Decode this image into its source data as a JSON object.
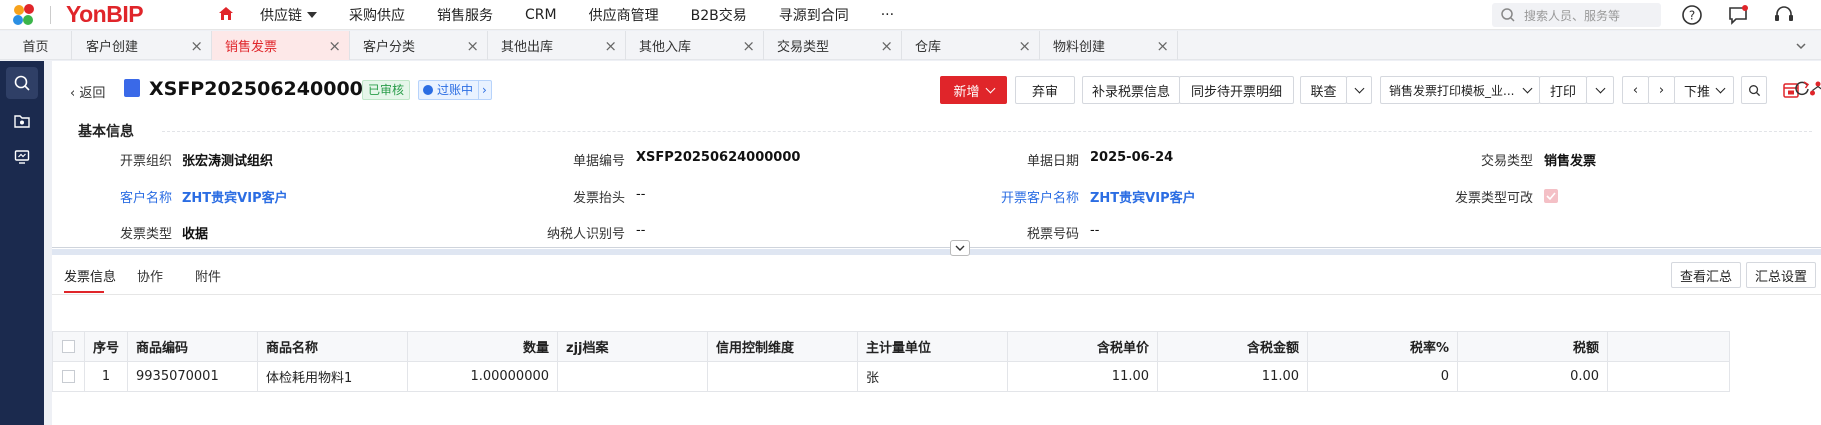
{
  "app": {
    "brand": "YonBIP",
    "nav": [
      {
        "label": "供应链",
        "has_dropdown": true
      },
      {
        "label": "采购供应"
      },
      {
        "label": "销售服务"
      },
      {
        "label": "CRM"
      },
      {
        "label": "供应商管理"
      },
      {
        "label": "B2B交易"
      },
      {
        "label": "寻源到合同"
      },
      {
        "label": "···"
      }
    ],
    "search_placeholder": "搜索人员、服务等"
  },
  "tabs": [
    {
      "label": "首页"
    },
    {
      "label": "客户创建"
    },
    {
      "label": "销售发票",
      "active": true
    },
    {
      "label": "客户分类"
    },
    {
      "label": "其他出库"
    },
    {
      "label": "其他入库"
    },
    {
      "label": "交易类型"
    },
    {
      "label": "仓库"
    },
    {
      "label": "物料创建"
    }
  ],
  "header": {
    "back_label": "返回",
    "doc_no": "XSFP20250624000000",
    "status_badge": "已审核",
    "posting_badge": "过账中",
    "buttons": {
      "new": "新增",
      "discard": "弃审",
      "add_tax_info": "补录税票信息",
      "sync_pending": "同步待开票明细",
      "linked": "联查",
      "print_template": "销售发票打印模板_业...",
      "print": "打印",
      "push_down": "下推"
    }
  },
  "basic_info": {
    "title": "基本信息",
    "fields": [
      {
        "label": "开票组织",
        "value": "张宏涛测试组织"
      },
      {
        "label": "单据编号",
        "value": "XSFP20250624000000"
      },
      {
        "label": "单据日期",
        "value": "2025-06-24"
      },
      {
        "label": "交易类型",
        "value": "销售发票"
      },
      {
        "label": "客户名称",
        "value": "ZHT贵宾VIP客户"
      },
      {
        "label": "发票抬头",
        "value": "--"
      },
      {
        "label": "开票客户名称",
        "value": "ZHT贵宾VIP客户"
      },
      {
        "label": "发票类型可改",
        "value": true
      },
      {
        "label": "发票类型",
        "value": "收据"
      },
      {
        "label": "纳税人识别号",
        "value": "--"
      },
      {
        "label": "税票号码",
        "value": "--"
      }
    ]
  },
  "detail": {
    "subtabs": [
      "发票信息",
      "协作",
      "附件"
    ],
    "buttons": {
      "view_summary": "查看汇总",
      "summary_settings": "汇总设置"
    },
    "columns": [
      "序号",
      "商品编码",
      "商品名称",
      "数量",
      "zjj档案",
      "信用控制维度",
      "主计量单位",
      "含税单价",
      "含税金额",
      "税率%",
      "税额"
    ],
    "rows": [
      {
        "seq": "1",
        "code": "9935070001",
        "name": "体检耗用物料1",
        "qty": "1.00000000",
        "zjj": "",
        "credit": "",
        "unit": "张",
        "price": "11.00",
        "amount": "11.00",
        "rate": "0",
        "tax": "0.00"
      }
    ]
  },
  "colors": {
    "accent": "#e0252a",
    "link": "#2b6de3",
    "sidebar": "#1b2a4e"
  }
}
